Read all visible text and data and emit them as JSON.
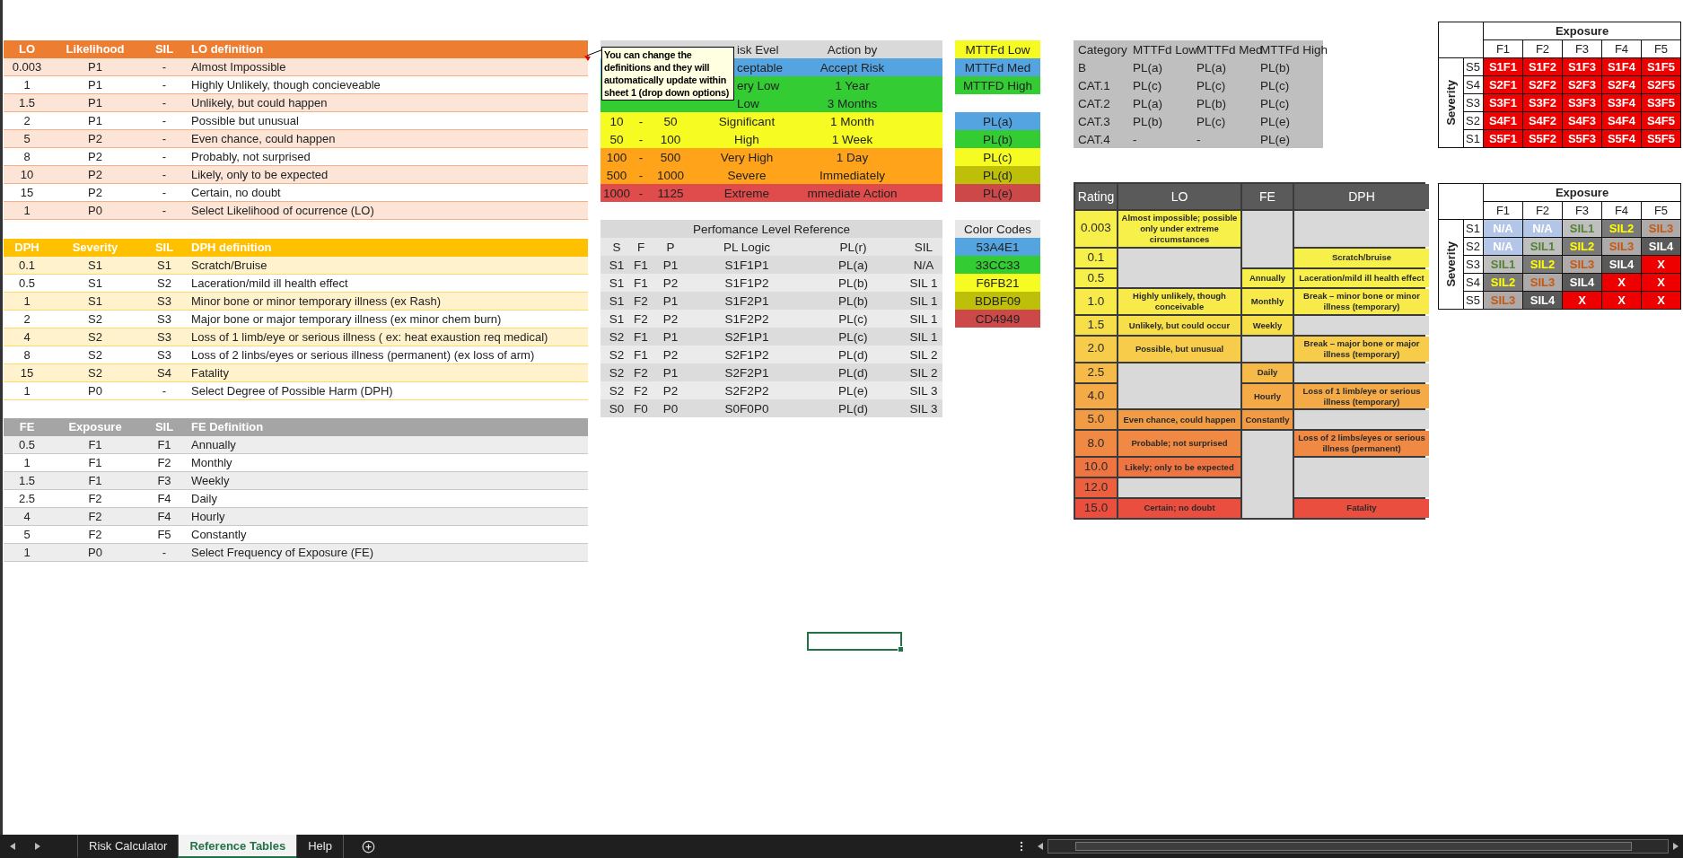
{
  "lo_table": {
    "columns": [
      "LO",
      "Likelihood",
      "SIL",
      "LO definition"
    ],
    "rows": [
      [
        "0.003",
        "P1",
        "-",
        "Almost Impossible"
      ],
      [
        "1",
        "P1",
        "-",
        "Highly Unlikely, though concieveable"
      ],
      [
        "1.5",
        "P1",
        "-",
        "Unlikely, but could happen"
      ],
      [
        "2",
        "P1",
        "-",
        "Possible but unusual"
      ],
      [
        "5",
        "P2",
        "-",
        "Even chance, could happen"
      ],
      [
        "8",
        "P2",
        "-",
        "Probably, not surprised"
      ],
      [
        "10",
        "P2",
        "-",
        "Likely, only to be expected"
      ],
      [
        "15",
        "P2",
        "-",
        "Certain, no doubt"
      ],
      [
        "1",
        "P0",
        "-",
        "Select Likelihood of ocurrence (LO)"
      ]
    ]
  },
  "dph_table": {
    "columns": [
      "DPH",
      "Severity",
      "SIL",
      "DPH definition"
    ],
    "rows": [
      [
        "0.1",
        "S1",
        "S1",
        "Scratch/Bruise"
      ],
      [
        "0.5",
        "S1",
        "S2",
        "Laceration/mild ill health effect"
      ],
      [
        "1",
        "S1",
        "S3",
        "Minor bone or minor temporary illness (ex Rash)"
      ],
      [
        "2",
        "S2",
        "S3",
        "Major bone or major temporary illness (ex  minor chem burn)"
      ],
      [
        "4",
        "S2",
        "S3",
        "Loss of 1 limb/eye or serious  illness ( ex: heat exaustion req medical)"
      ],
      [
        "8",
        "S2",
        "S3",
        "Loss of 2 linbs/eyes or serious illness (permanent) (ex loss of arm)"
      ],
      [
        "15",
        "S2",
        "S4",
        "Fatality"
      ],
      [
        "1",
        "P0",
        "-",
        "Select Degree of Possible Harm (DPH)"
      ]
    ]
  },
  "fe_table": {
    "columns": [
      "FE",
      "Exposure",
      "SIL",
      "FE Definition"
    ],
    "rows": [
      [
        "0.5",
        "F1",
        "F1",
        "Annually"
      ],
      [
        "1",
        "F1",
        "F2",
        "Monthly"
      ],
      [
        "1.5",
        "F1",
        "F3",
        "Weekly"
      ],
      [
        "2.5",
        "F2",
        "F4",
        "Daily"
      ],
      [
        "4",
        "F2",
        "F4",
        "Hourly"
      ],
      [
        "5",
        "F2",
        "F5",
        "Constantly"
      ],
      [
        "1",
        "P0",
        "-",
        "Select Frequency of Exposure (FE)"
      ]
    ]
  },
  "comment": {
    "text": "You can change the definitions and they will automatically update within sheet 1 (drop down options)"
  },
  "risk_table": {
    "columns": [
      "isk Evel",
      "Action by"
    ],
    "rows": [
      {
        "level": "ceptable",
        "action": "Accept Risk",
        "color": "#53a4e1"
      },
      {
        "level": "ery Low",
        "action": "1 Year",
        "color": "#33cc33"
      },
      {
        "level": "Low",
        "action": "3 Months",
        "color": "#33cc33"
      },
      {
        "from": "10",
        "sep": "-",
        "to": "50",
        "level": "Significant",
        "action": "1 Month",
        "color": "#f6fb21"
      },
      {
        "from": "50",
        "sep": "-",
        "to": "100",
        "level": "High",
        "action": "1 Week",
        "color": "#f6fb21"
      },
      {
        "from": "100",
        "sep": "-",
        "to": "500",
        "level": "Very High",
        "action": "1 Day",
        "color": "#ffa31a"
      },
      {
        "from": "500",
        "sep": "-",
        "to": "1000",
        "level": "Severe",
        "action": "Immediately",
        "color": "#ffa31a"
      },
      {
        "from": "1000",
        "sep": "-",
        "to": "1125",
        "level": "Extreme",
        "action": "mmediate Action",
        "color": "#e04b4b"
      }
    ]
  },
  "performance_table": {
    "title": "Perfomance Level Reference",
    "columns": [
      "S",
      "F",
      "P",
      "PL Logic",
      "PL(r)",
      "SIL"
    ],
    "rows": [
      [
        "S1",
        "F1",
        "P1",
        "S1F1P1",
        "PL(a)",
        "N/A"
      ],
      [
        "S1",
        "F1",
        "P2",
        "S1F1P2",
        "PL(b)",
        "SIL 1"
      ],
      [
        "S1",
        "F2",
        "P1",
        "S1F2P1",
        "PL(b)",
        "SIL 1"
      ],
      [
        "S1",
        "F2",
        "P2",
        "S1F2P2",
        "PL(c)",
        "SIL 1"
      ],
      [
        "S2",
        "F1",
        "P1",
        "S2F1P1",
        "PL(c)",
        "SIL 1"
      ],
      [
        "S2",
        "F1",
        "P2",
        "S2F1P2",
        "PL(d)",
        "SIL 2"
      ],
      [
        "S2",
        "F2",
        "P1",
        "S2F2P1",
        "PL(d)",
        "SIL 2"
      ],
      [
        "S2",
        "F2",
        "P2",
        "S2F2P2",
        "PL(e)",
        "SIL 3"
      ],
      [
        "S0",
        "F0",
        "P0",
        "S0F0P0",
        "PL(d)",
        "SIL 3"
      ]
    ]
  },
  "mttfd_legend": [
    {
      "label": "MTTFd Low",
      "color": "#f6fb21"
    },
    {
      "label": "MTTFd Med",
      "color": "#53a4e1"
    },
    {
      "label": "MTTFD High",
      "color": "#33cc33"
    }
  ],
  "pl_legend": [
    {
      "label": "PL(a)",
      "color": "#53a4e1"
    },
    {
      "label": "PL(b)",
      "color": "#33cc33"
    },
    {
      "label": "PL(c)",
      "color": "#f6fb21"
    },
    {
      "label": "PL(d)",
      "color": "#bdbf09"
    },
    {
      "label": "PL(e)",
      "color": "#cd4949"
    }
  ],
  "color_codes": {
    "title": "Color Codes",
    "items": [
      {
        "label": "53A4E1",
        "color": "#53a4e1"
      },
      {
        "label": "33CC33",
        "color": "#33cc33"
      },
      {
        "label": "F6FB21",
        "color": "#f6fb21"
      },
      {
        "label": "BDBF09",
        "color": "#bdbf09"
      },
      {
        "label": "CD4949",
        "color": "#cd4949"
      }
    ]
  },
  "category_table": {
    "columns": [
      "Category",
      "MTTFd Low",
      "MTTFd Med",
      "MTTFd High"
    ],
    "rows": [
      [
        "B",
        "PL(a)",
        "PL(a)",
        "PL(b)"
      ],
      [
        "CAT.1",
        "PL(c)",
        "PL(c)",
        "PL(c)"
      ],
      [
        "CAT.2",
        "PL(a)",
        "PL(b)",
        "PL(c)"
      ],
      [
        "CAT.3",
        "PL(b)",
        "PL(c)",
        "PL(e)"
      ],
      [
        "CAT.4",
        "-",
        "-",
        "PL(e)"
      ]
    ]
  },
  "rating_table": {
    "columns": [
      "Rating",
      "LO",
      "FE",
      "DPH"
    ],
    "rows": [
      {
        "rating": "0.003",
        "color": "#f7ef4a",
        "lo": "Almost impossible; possible only under extreme circumstances"
      },
      {
        "rating": "0.1",
        "color": "#f7ef4a",
        "dph": "Scratch/bruise"
      },
      {
        "rating": "0.5",
        "color": "#f7ef4a",
        "fe": "Annually",
        "dph": "Laceration/mild ill health effect"
      },
      {
        "rating": "1.0",
        "color": "#f7ea4a",
        "lo": "Highly unlikely, though conceivable",
        "fe": "Monthly",
        "dph": "Break – minor bone or minor illness (temporary)"
      },
      {
        "rating": "1.5",
        "color": "#f7df4a",
        "lo": "Unlikely, but could occur",
        "fe": "Weekly"
      },
      {
        "rating": "2.0",
        "color": "#f6cc4a",
        "lo": "Possible, but unusual",
        "dph": "Break – major bone or major illness (temporary)"
      },
      {
        "rating": "2.5",
        "color": "#f5ba48",
        "fe": "Daily"
      },
      {
        "rating": "4.0",
        "color": "#f4aa47",
        "fe": "Hourly",
        "dph": "Loss of 1 limb/eye or serious illness (temporary)"
      },
      {
        "rating": "5.0",
        "color": "#f29b45",
        "lo": "Even chance, could happen",
        "fe": "Constantly"
      },
      {
        "rating": "8.0",
        "color": "#f08943",
        "lo": "Probable; not surprised",
        "dph": "Loss of 2 limbs/eyes or serious illness (permanent)"
      },
      {
        "rating": "10.0",
        "color": "#ee7441",
        "lo": "Likely; only to be expected"
      },
      {
        "rating": "12.0",
        "color": "#ec6040"
      },
      {
        "rating": "15.0",
        "color": "#ea4e3e",
        "lo": "Certain; no doubt",
        "dph": "Fatality"
      }
    ]
  },
  "matrices": [
    {
      "title": "Exposure",
      "axis": "Severity",
      "columns": [
        "F1",
        "F2",
        "F3",
        "F4",
        "F5"
      ],
      "rows": [
        {
          "label": "S5",
          "cells": [
            {
              "text": "S1F1",
              "kind": "red"
            },
            {
              "text": "S1F2",
              "kind": "red"
            },
            {
              "text": "S1F3",
              "kind": "red"
            },
            {
              "text": "S1F4",
              "kind": "red"
            },
            {
              "text": "S1F5",
              "kind": "red"
            }
          ]
        },
        {
          "label": "S4",
          "cells": [
            {
              "text": "S2F1",
              "kind": "red"
            },
            {
              "text": "S2F2",
              "kind": "red"
            },
            {
              "text": "S2F3",
              "kind": "red"
            },
            {
              "text": "S2F4",
              "kind": "red"
            },
            {
              "text": "S2F5",
              "kind": "red"
            }
          ]
        },
        {
          "label": "S3",
          "cells": [
            {
              "text": "S3F1",
              "kind": "red"
            },
            {
              "text": "S3F2",
              "kind": "red"
            },
            {
              "text": "S3F3",
              "kind": "red"
            },
            {
              "text": "S3F4",
              "kind": "red"
            },
            {
              "text": "S3F5",
              "kind": "red"
            }
          ]
        },
        {
          "label": "S2",
          "cells": [
            {
              "text": "S4F1",
              "kind": "red"
            },
            {
              "text": "S4F2",
              "kind": "red"
            },
            {
              "text": "S4F3",
              "kind": "red"
            },
            {
              "text": "S4F4",
              "kind": "red"
            },
            {
              "text": "S4F5",
              "kind": "red"
            }
          ]
        },
        {
          "label": "S1",
          "cells": [
            {
              "text": "S5F1",
              "kind": "red"
            },
            {
              "text": "S5F2",
              "kind": "red"
            },
            {
              "text": "S5F3",
              "kind": "red"
            },
            {
              "text": "S5F4",
              "kind": "red"
            },
            {
              "text": "S5F5",
              "kind": "red"
            }
          ]
        }
      ]
    },
    {
      "title": "Exposure",
      "axis": "Severity",
      "columns": [
        "F1",
        "F2",
        "F3",
        "F4",
        "F5"
      ],
      "rows": [
        {
          "label": "S1",
          "cells": [
            {
              "text": "N/A",
              "kind": "na"
            },
            {
              "text": "N/A",
              "kind": "na"
            },
            {
              "text": "SIL1",
              "kind": "sil1"
            },
            {
              "text": "SIL2",
              "kind": "sil2"
            },
            {
              "text": "SIL3",
              "kind": "sil3"
            }
          ]
        },
        {
          "label": "S2",
          "cells": [
            {
              "text": "N/A",
              "kind": "na"
            },
            {
              "text": "SIL1",
              "kind": "sil1"
            },
            {
              "text": "SIL2",
              "kind": "sil2"
            },
            {
              "text": "SIL3",
              "kind": "sil3"
            },
            {
              "text": "SIL4",
              "kind": "sil4"
            }
          ]
        },
        {
          "label": "S3",
          "cells": [
            {
              "text": "SIL1",
              "kind": "sil1"
            },
            {
              "text": "SIL2",
              "kind": "sil2"
            },
            {
              "text": "SIL3",
              "kind": "sil3"
            },
            {
              "text": "SIL4",
              "kind": "sil4"
            },
            {
              "text": "X",
              "kind": "x"
            }
          ]
        },
        {
          "label": "S4",
          "cells": [
            {
              "text": "SIL2",
              "kind": "sil2"
            },
            {
              "text": "SIL3",
              "kind": "sil3"
            },
            {
              "text": "SIL4",
              "kind": "sil4"
            },
            {
              "text": "X",
              "kind": "x"
            },
            {
              "text": "X",
              "kind": "x"
            }
          ]
        },
        {
          "label": "S5",
          "cells": [
            {
              "text": "SIL3",
              "kind": "sil3"
            },
            {
              "text": "SIL4",
              "kind": "sil4"
            },
            {
              "text": "X",
              "kind": "x"
            },
            {
              "text": "X",
              "kind": "x"
            },
            {
              "text": "X",
              "kind": "x"
            }
          ]
        }
      ]
    }
  ],
  "sheet_tabs": [
    {
      "label": "Risk Calculator",
      "selected": false
    },
    {
      "label": "Reference Tables",
      "selected": true
    },
    {
      "label": "Help",
      "selected": false
    }
  ]
}
